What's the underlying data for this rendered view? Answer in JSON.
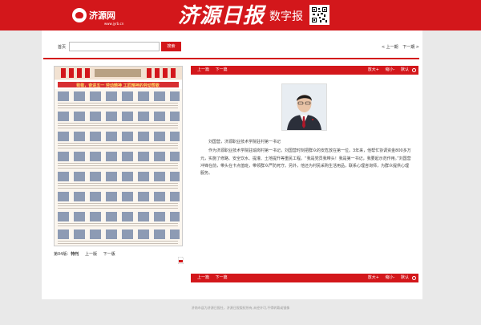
{
  "header": {
    "logo_text": "济源网",
    "logo_url": "www.jyrb.cn",
    "brand_name": "济源日报",
    "brand_sub": "数字报"
  },
  "toolbar": {
    "home_label": "首页",
    "search_value": "",
    "search_button": "搜索",
    "prev_issue": "< 上一期",
    "next_issue": "下一期 >"
  },
  "left": {
    "banner_text": "致敬，奋进五一劳动者致敬奋斗者，弘扬劳模精神，劳动精神，工匠精神的劳动赞歌",
    "page_label": "第04版：",
    "page_name": "特刊",
    "prev_page": "上一版",
    "next_page": "下一版"
  },
  "article_bar": {
    "prev_article": "上一篇",
    "next_article": "下一篇",
    "zoom_in": "放大+",
    "zoom_out": "缩小-",
    "default": "默认"
  },
  "article": {
    "caption": "刘国营，济源职业技术学院驻村第一书记",
    "body": "作为济源职业技术学院驻瑜岗村第一书记，刘国营时刻把群众的安危放在第一位。3年来，他帮忙协调资金800多万元，实施了修路、安全饮水、提灌、土地提升等重民工程。“我是党员我带头！我是第一书记，我要起示范作用。”刘国营冲锋在前，带头在卡点值班，带领群众严防死守。另外，他还为村民采购生活用品，联系心理咨询师，为群众提供心理服务。"
  },
  "footer": {
    "text": "济南市县为济源日报社，济源日报版权所有,未经许可,不得转载或镜像"
  },
  "colors": {
    "brand_red": "#d3171b",
    "page_bg": "#e9e9e9"
  }
}
